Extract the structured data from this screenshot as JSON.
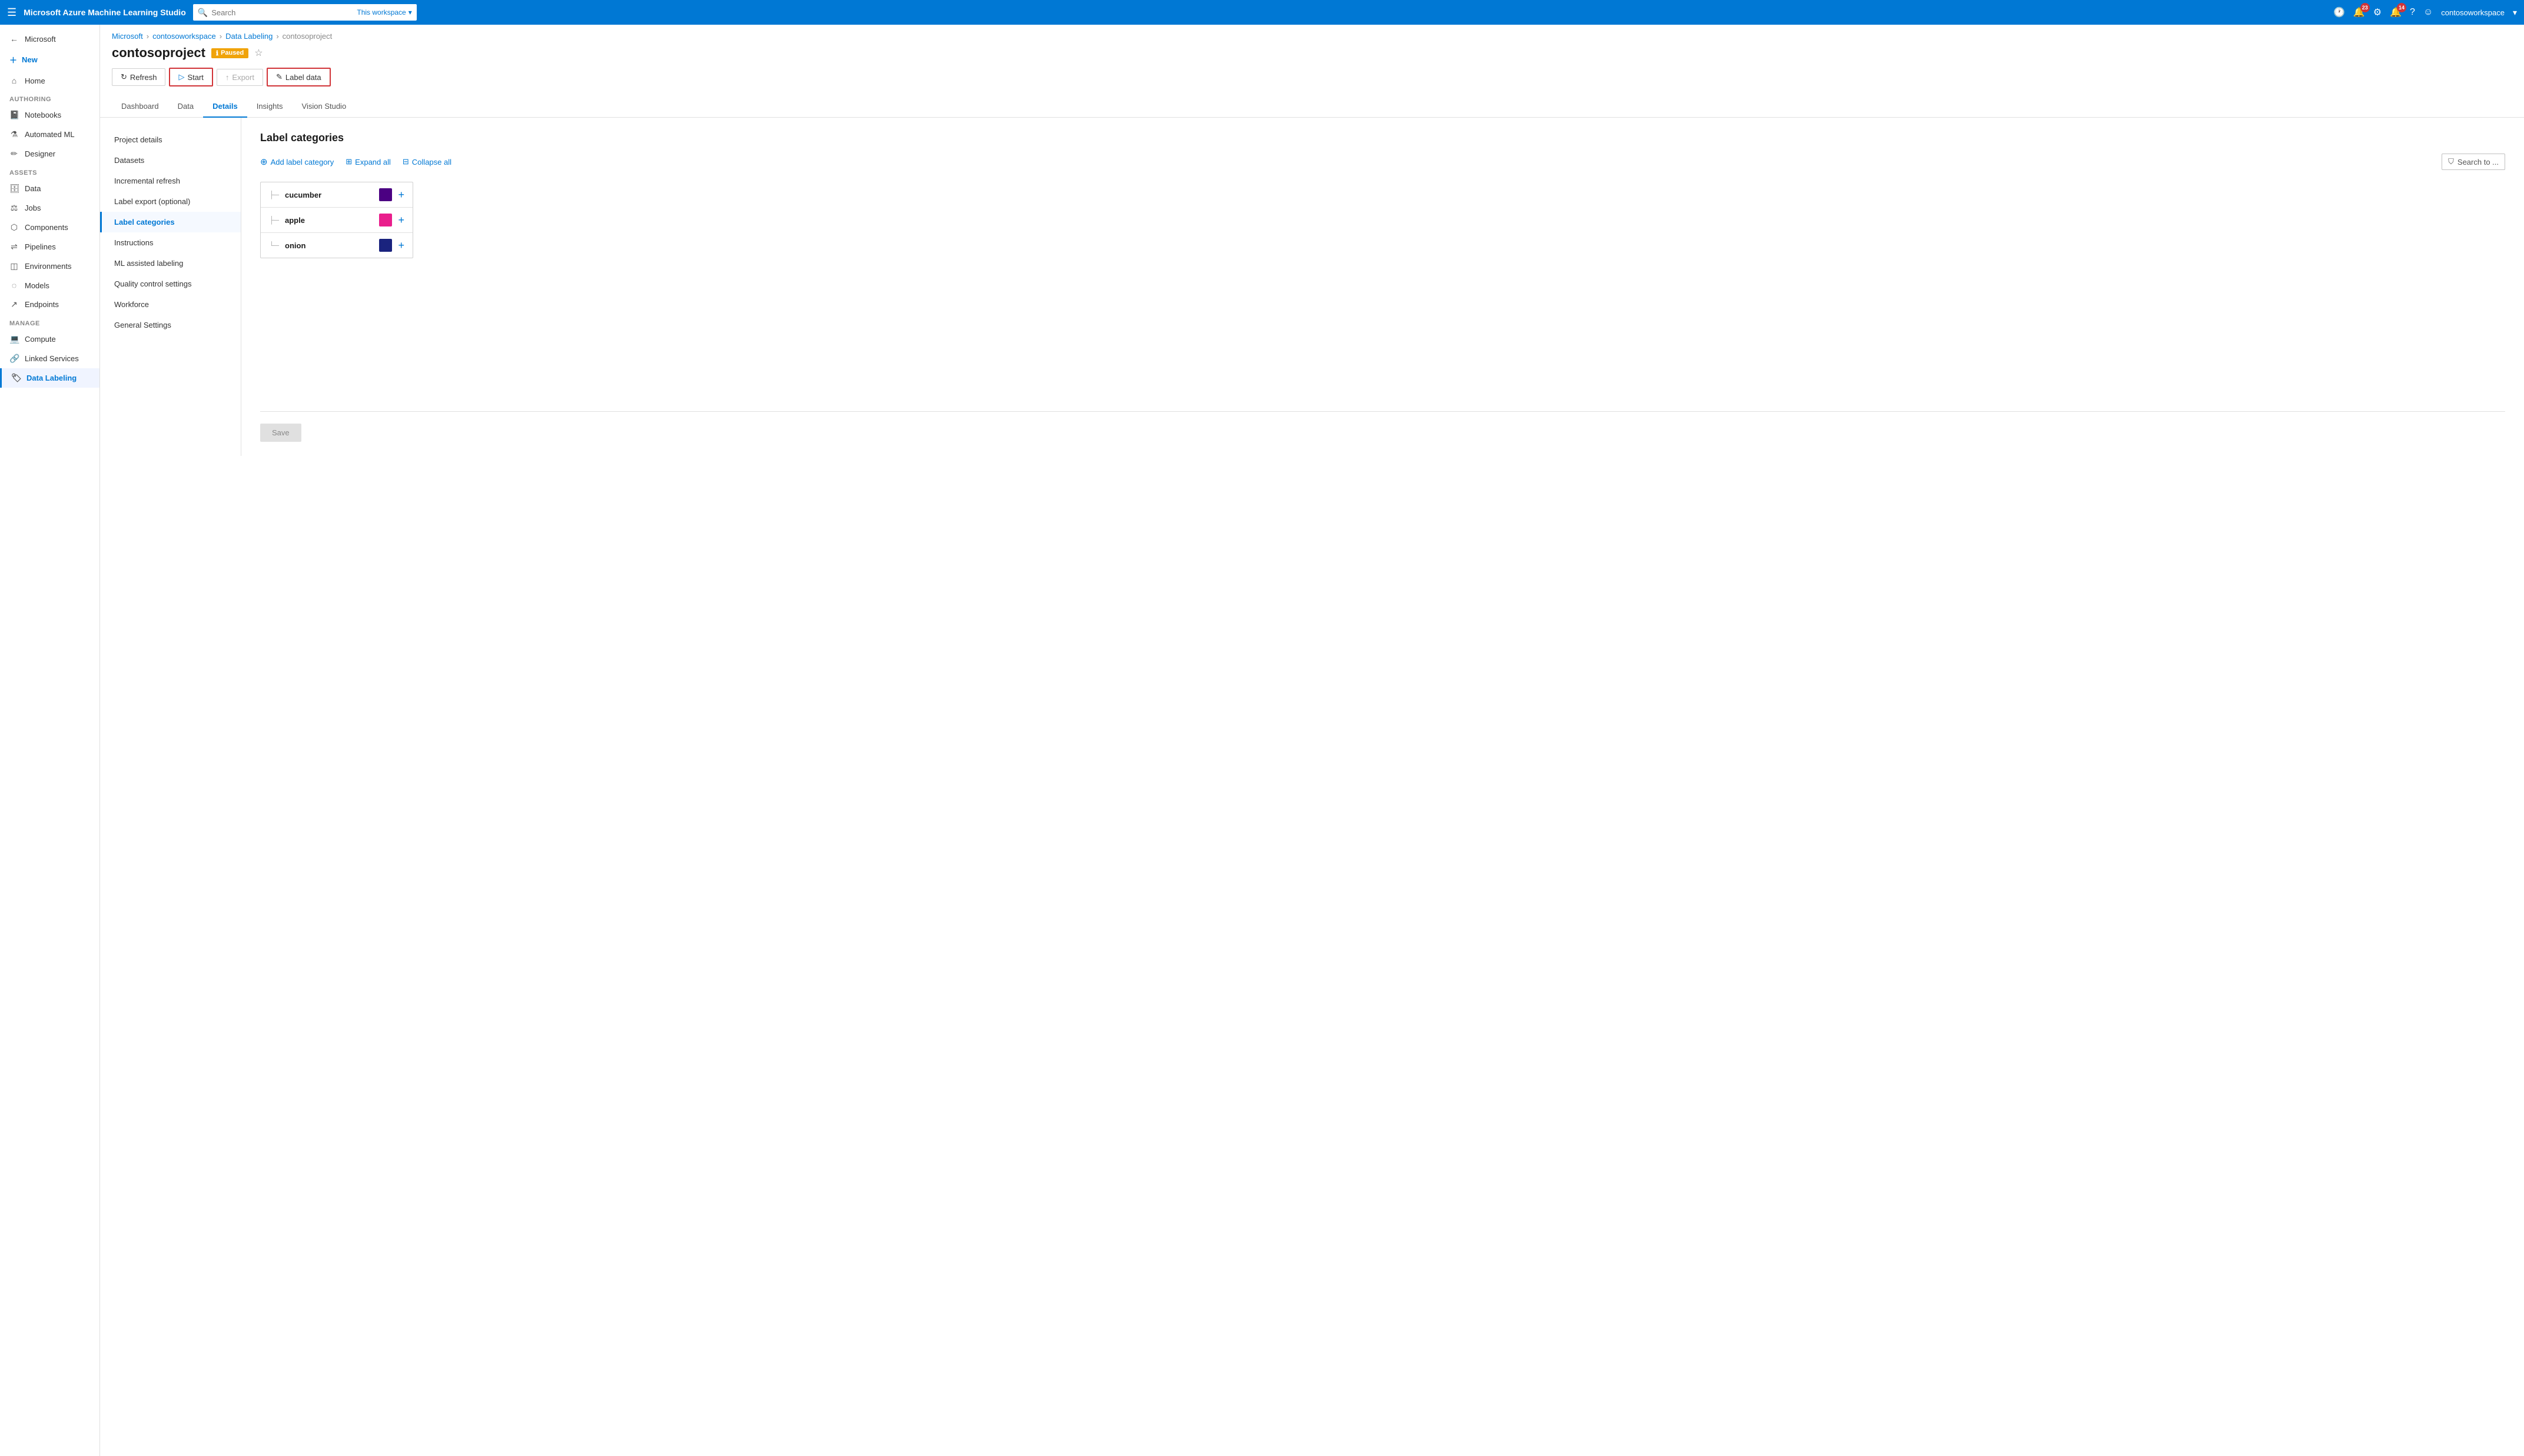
{
  "topNav": {
    "title": "Microsoft Azure Machine Learning Studio",
    "searchPlaceholder": "Search",
    "searchScope": "This workspace",
    "icons": {
      "clock": "🕐",
      "notifications_count": "23",
      "settings": "⚙",
      "alerts_count": "14",
      "help": "?",
      "smiley": "☺"
    },
    "username": "contosoworkspace"
  },
  "sidebar": {
    "hamburger": "☰",
    "microsoft_label": "Microsoft",
    "new_label": "New",
    "home_label": "Home",
    "authoring_label": "Authoring",
    "notebooks_label": "Notebooks",
    "automated_ml_label": "Automated ML",
    "designer_label": "Designer",
    "assets_label": "Assets",
    "data_label": "Data",
    "jobs_label": "Jobs",
    "components_label": "Components",
    "pipelines_label": "Pipelines",
    "environments_label": "Environments",
    "models_label": "Models",
    "endpoints_label": "Endpoints",
    "manage_label": "Manage",
    "compute_label": "Compute",
    "linked_services_label": "Linked Services",
    "data_labeling_label": "Data Labeling"
  },
  "breadcrumb": {
    "microsoft": "Microsoft",
    "workspace": "contosoworkspace",
    "data_labeling": "Data Labeling",
    "project": "contosoproject"
  },
  "pageHeader": {
    "title": "contosoproject",
    "status": "Paused",
    "status_icon": "ℹ",
    "refresh_label": "Refresh",
    "start_label": "Start",
    "export_label": "Export",
    "label_data_label": "Label data"
  },
  "tabs": [
    "Dashboard",
    "Data",
    "Details",
    "Insights",
    "Vision Studio"
  ],
  "activeTab": "Details",
  "leftNav": [
    "Project details",
    "Datasets",
    "Incremental refresh",
    "Label export (optional)",
    "Label categories",
    "Instructions",
    "ML assisted labeling",
    "Quality control settings",
    "Workforce",
    "General Settings"
  ],
  "activeLeftNav": "Label categories",
  "labelCategories": {
    "title": "Label categories",
    "add_label": "Add label category",
    "expand_label": "Expand all",
    "collapse_label": "Collapse all",
    "search_placeholder": "Search to ...",
    "items": [
      {
        "name": "cucumber",
        "color": "#4b0082"
      },
      {
        "name": "apple",
        "color": "#e91e8c"
      },
      {
        "name": "onion",
        "color": "#1a237e"
      }
    ]
  },
  "saveButton": "Save"
}
